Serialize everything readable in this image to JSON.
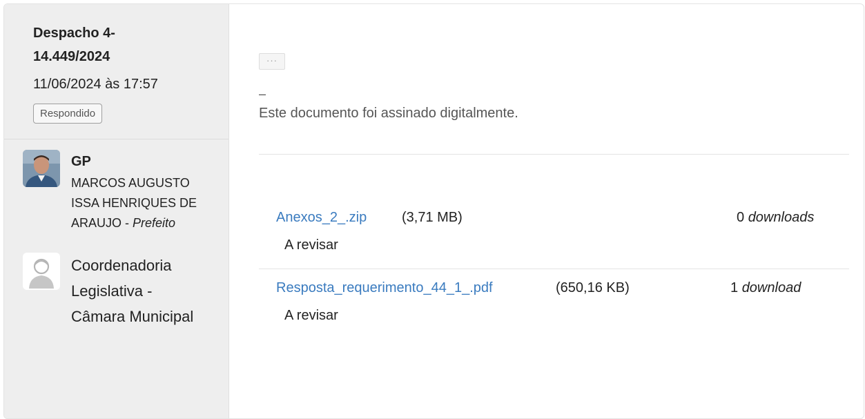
{
  "document": {
    "title": "Despacho 4-14.449/2024",
    "date": "11/06/2024 às 17:57",
    "status_badge": "Respondido"
  },
  "people": [
    {
      "abbr": "GP",
      "name": "MARCOS AUGUSTO ISSA HENRIQUES DE ARAUJO - ",
      "role": "Prefeito",
      "avatar_icon": "person-photo-icon"
    },
    {
      "org": "Coordenadoria Legislativa - Câmara Municipal",
      "avatar_icon": "user-placeholder-icon"
    }
  ],
  "content": {
    "ellipsis_label": "···",
    "dash": "–",
    "signed_text": "Este documento foi assinado digitalmente."
  },
  "attachments": [
    {
      "filename": "Anexos_2_.zip",
      "size": "(3,71 MB)",
      "status": "A revisar",
      "download_count": "0",
      "download_word": "downloads"
    },
    {
      "filename": "Resposta_requerimento_44_1_.pdf",
      "size": "(650,16 KB)",
      "status": "A revisar",
      "download_count": "1",
      "download_word": "download"
    }
  ],
  "colors": {
    "link": "#3a7bbf",
    "sidebar_bg": "#eeeeee",
    "text": "#222222"
  }
}
